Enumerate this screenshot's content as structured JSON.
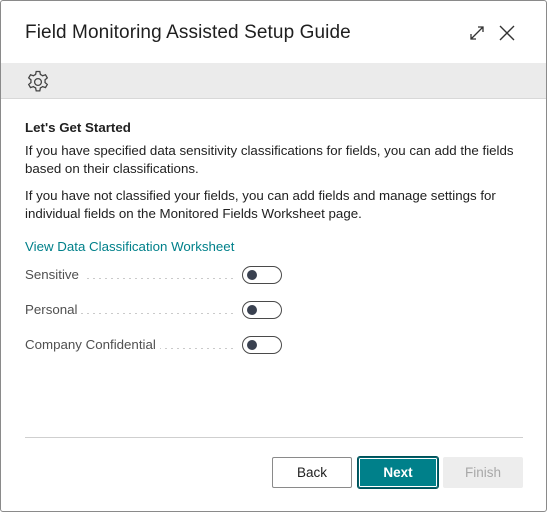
{
  "dialog": {
    "title": "Field Monitoring Assisted Setup Guide",
    "expand_icon": "expand-icon",
    "close_icon": "close-icon"
  },
  "toolbar": {
    "settings_icon": "gear-icon"
  },
  "content": {
    "section_title": "Let's Get Started",
    "paragraph_1": "If you have specified data sensitivity classifications for fields, you can add the fields based on their classifications.",
    "paragraph_2": "If you have not classified your fields, you can add fields and manage settings for individual fields on the Monitored Fields Worksheet page.",
    "link": "View Data Classification Worksheet"
  },
  "options": [
    {
      "label": "Sensitive",
      "enabled": false
    },
    {
      "label": "Personal",
      "enabled": false
    },
    {
      "label": "Company Confidential",
      "enabled": false
    }
  ],
  "footer": {
    "back_label": "Back",
    "next_label": "Next",
    "finish_label": "Finish"
  },
  "colors": {
    "accent": "#00808a",
    "toolbar_bg": "#ebebeb"
  }
}
